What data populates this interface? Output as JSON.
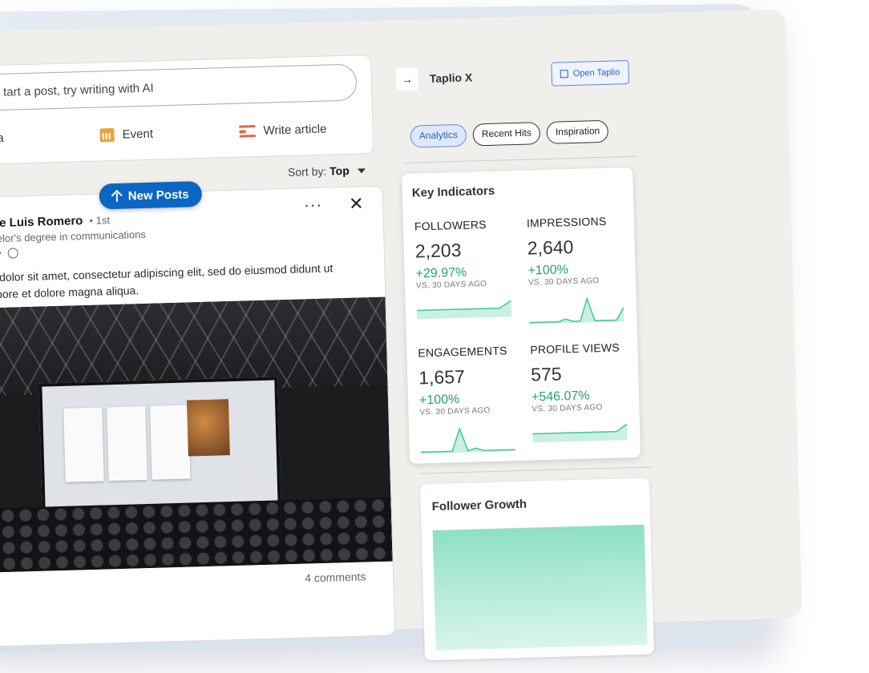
{
  "composer": {
    "start_post": "tart a post, try writing with AI",
    "media_label": "dia",
    "event_label": "Event",
    "write_article_label": "Write article"
  },
  "feed": {
    "sort_label": "Sort by:",
    "sort_value": "Top",
    "new_posts_label": "New Posts"
  },
  "post": {
    "author": "ose Luis Romero",
    "degree": "• 1st",
    "headline": "chelor's degree in communications",
    "meta": "m •",
    "text": "m dolor sit amet, consectetur adipiscing elit, sed do eiusmod didunt ut labore et dolore magna aliqua.",
    "more": "···",
    "close": "✕",
    "comments": "4 comments"
  },
  "sidebar": {
    "app_name": "Taplio X",
    "open_button": "Open Taplio",
    "tabs": [
      "Analytics",
      "Recent Hits",
      "Inspiration"
    ],
    "active_tab": "Analytics"
  },
  "key_indicators": {
    "title": "Key Indicators",
    "metrics": [
      {
        "label": "FOLLOWERS",
        "value": "2,203",
        "delta": "+29.97%",
        "compare": "VS. 30 DAYS AGO",
        "spark": [
          1,
          1,
          1,
          1,
          1,
          1,
          1,
          1,
          2
        ]
      },
      {
        "label": "IMPRESSIONS",
        "value": "2,640",
        "delta": "+100%",
        "compare": "VS. 30 DAYS AGO",
        "spark": [
          0,
          0,
          0,
          0,
          0,
          1,
          0,
          0,
          9,
          0,
          0,
          0,
          0,
          5
        ]
      },
      {
        "label": "ENGAGEMENTS",
        "value": "1,657",
        "delta": "+100%",
        "compare": "VS. 30 DAYS AGO",
        "spark": [
          0,
          0,
          0,
          0,
          0,
          9,
          0,
          1,
          0,
          0,
          0,
          0,
          0
        ]
      },
      {
        "label": "PROFILE VIEWS",
        "value": "575",
        "delta": "+546.07%",
        "compare": "VS. 30 DAYS AGO",
        "spark": [
          1,
          1,
          1,
          1,
          1,
          1,
          1,
          1,
          1,
          2
        ]
      }
    ]
  },
  "follower_growth": {
    "title": "Follower Growth"
  },
  "colors": {
    "accent_blue": "#0a66c2",
    "positive_green": "#23a26d",
    "spark_green": "#3cc79a"
  },
  "icons": {
    "arrow": "arrow-right-icon",
    "event": "calendar-icon",
    "article": "article-icon",
    "globe": "globe-icon",
    "external": "external-link-icon"
  }
}
